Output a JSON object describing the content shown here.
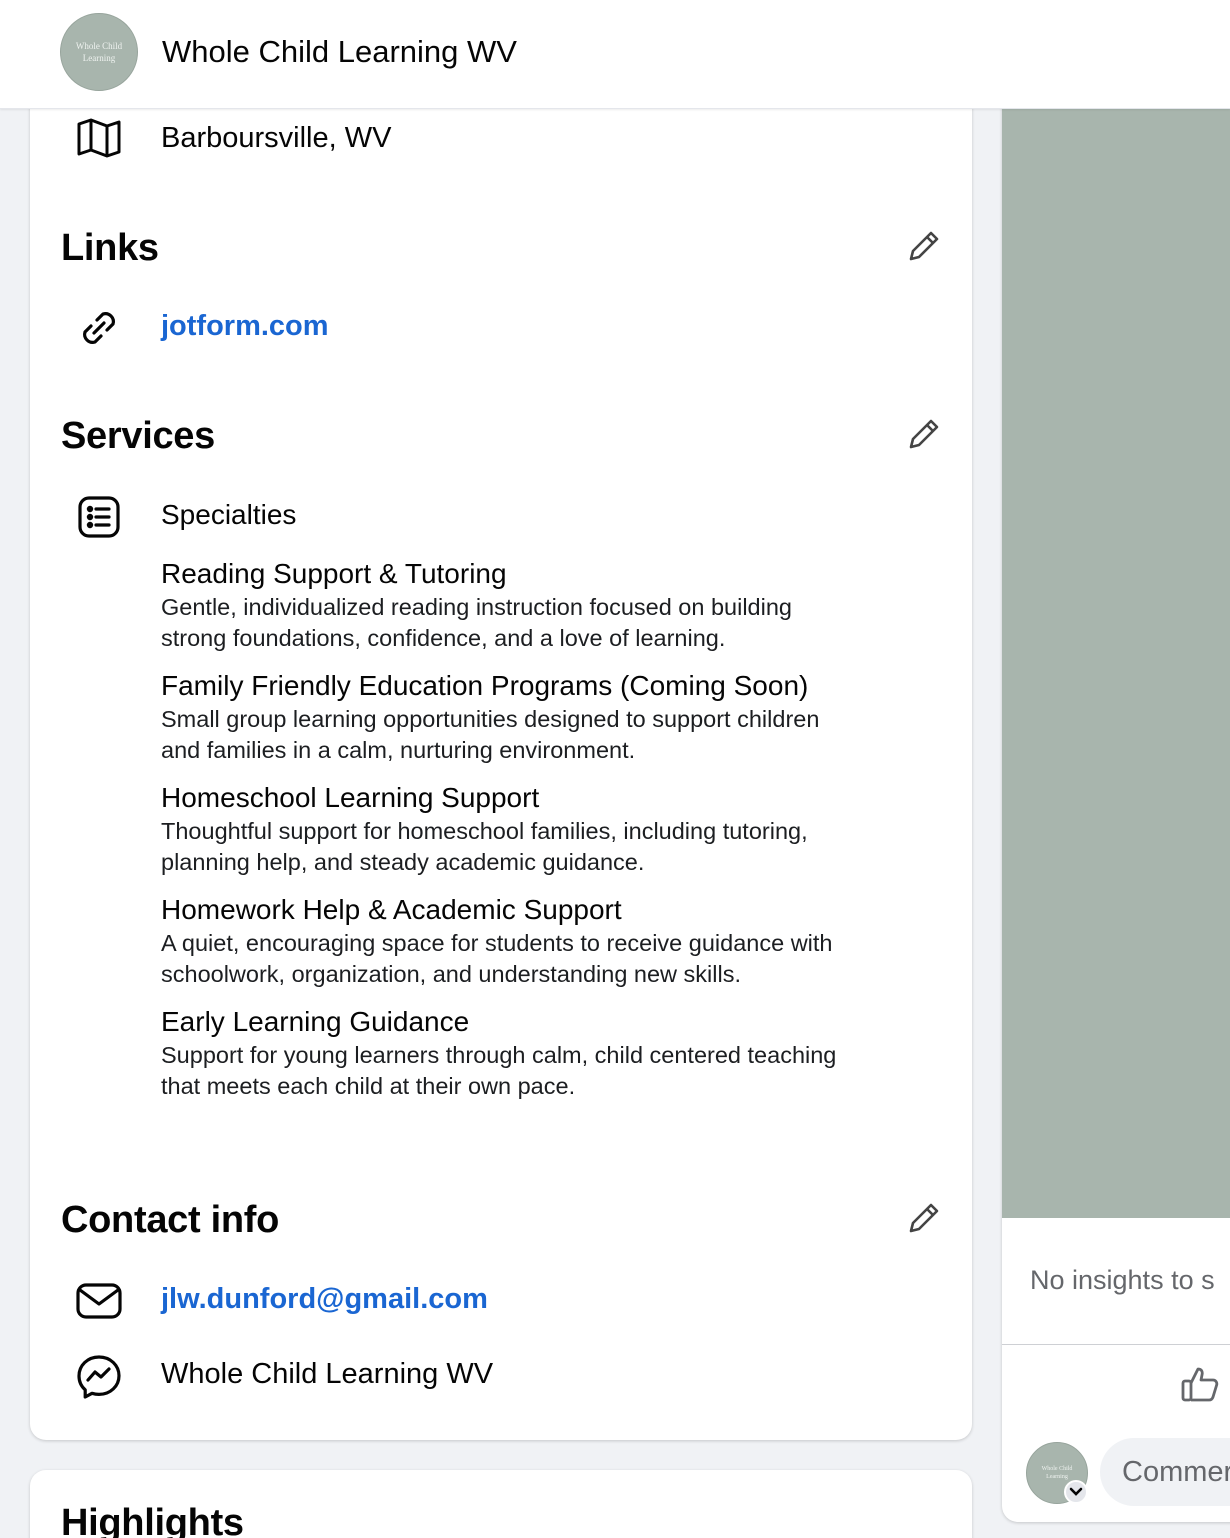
{
  "header": {
    "page_name": "Whole Child Learning WV",
    "avatar_text_line1": "Whole Child",
    "avatar_text_line2": "Learning"
  },
  "intro": {
    "location": "Barboursville, WV",
    "location_icon": "map-icon"
  },
  "links": {
    "title": "Links",
    "website": "jotform.com",
    "link_icon": "link-icon"
  },
  "services": {
    "title": "Services",
    "specialties_label": "Specialties",
    "items": [
      {
        "title": "Reading Support & Tutoring",
        "desc_line1": "Gentle, individualized reading instruction focused on building",
        "desc_line2": "strong foundations, confidence, and a love of learning."
      },
      {
        "title": "Family Friendly Education Programs (Coming Soon)",
        "desc_line1": "Small group learning opportunities designed to support children",
        "desc_line2": "and families in a calm, nurturing environment."
      },
      {
        "title": "Homeschool Learning Support",
        "desc_line1": "Thoughtful support for homeschool families, including tutoring,",
        "desc_line2": "planning help, and steady academic guidance."
      },
      {
        "title": "Homework Help & Academic Support",
        "desc_line1": "A quiet, encouraging space for students to receive guidance with",
        "desc_line2": "schoolwork, organization, and understanding new skills."
      },
      {
        "title": "Early Learning Guidance",
        "desc_line1": "Support for young learners through calm, child centered teaching",
        "desc_line2": "that meets each child at their own pace."
      }
    ]
  },
  "contact": {
    "title": "Contact info",
    "email": "jlw.dunford@gmail.com",
    "messenger": "Whole Child Learning WV"
  },
  "highlights": {
    "title": "Highlights"
  },
  "post": {
    "insights_text": "No insights to s",
    "comment_placeholder": "Commer"
  },
  "colors": {
    "link_blue": "#1a66d2",
    "sage": "#a8b5ad",
    "page_bg": "#f0f2f5"
  }
}
